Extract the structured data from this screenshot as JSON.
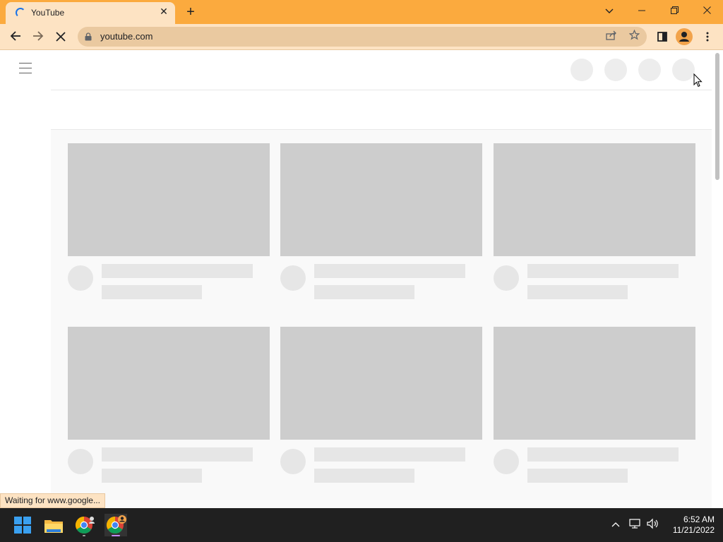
{
  "browser": {
    "tab_title": "YouTube",
    "tab_close_glyph": "✕",
    "new_tab_glyph": "+",
    "url": "youtube.com",
    "status_text": "Waiting for www.google...",
    "window_controls": {
      "dropdown": "⌄",
      "minimize": "—",
      "restore": "❐",
      "close": "✕"
    },
    "nav": {
      "back": "←",
      "forward": "→",
      "stop": "✕"
    },
    "toolbar_icons": {
      "share": "⇪",
      "bookmark": "☆",
      "menu": "⋮"
    },
    "accent_color": "#fbaa3e"
  },
  "taskbar": {
    "time": "6:52 AM",
    "date": "11/21/2022",
    "tray": {
      "chevron": "^",
      "network": "🖧",
      "volume": "🔊"
    }
  }
}
